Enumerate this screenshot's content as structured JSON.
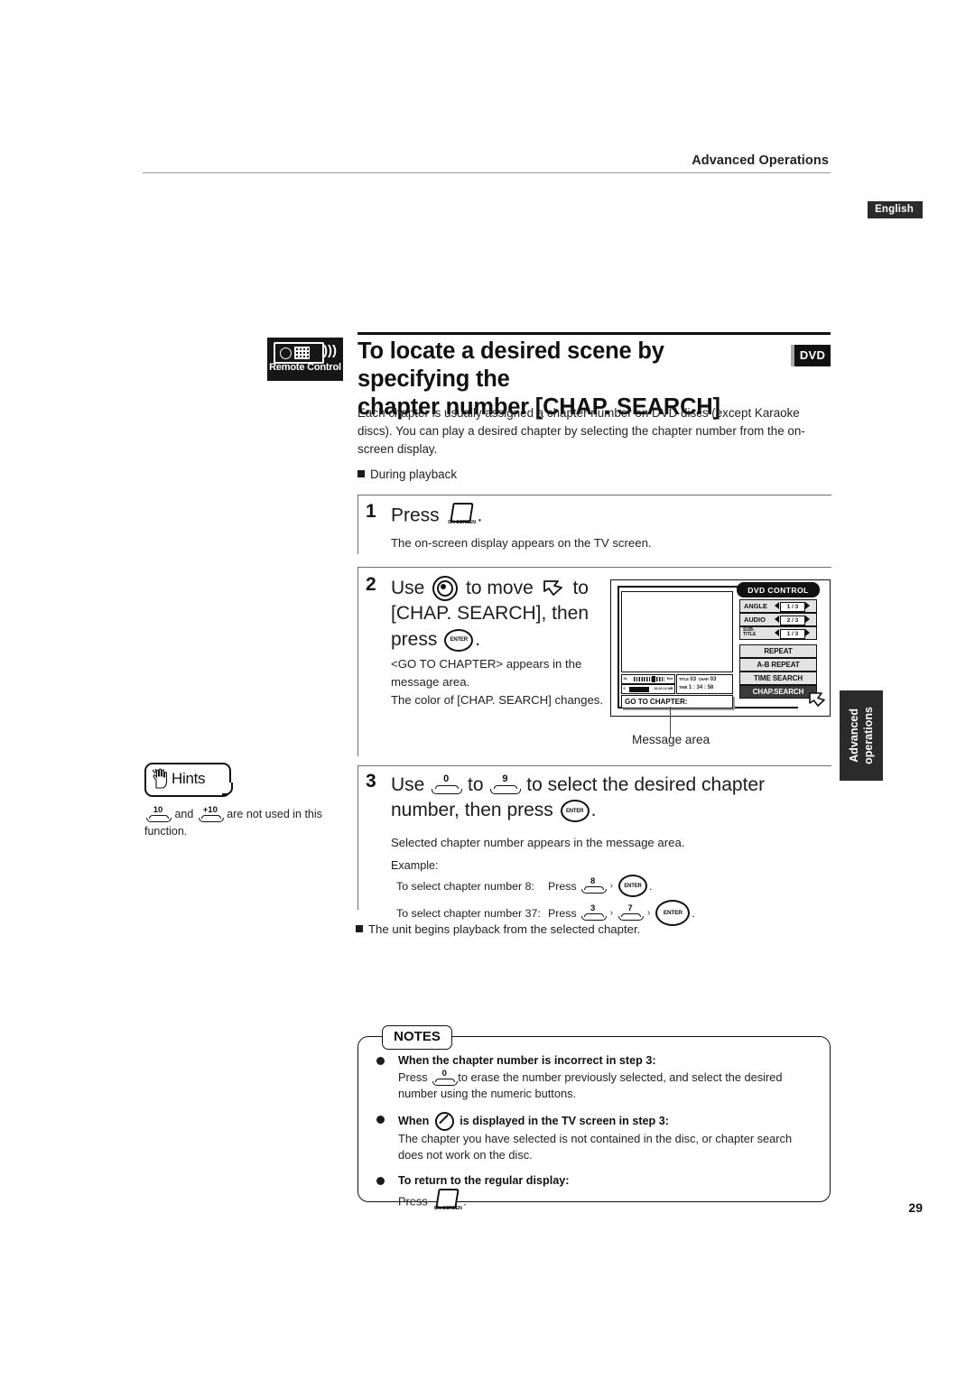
{
  "header": {
    "running_title": "Advanced Operations",
    "language_badge": "English"
  },
  "heading": {
    "remote_badge_label": "Remote Control",
    "title_line1": "To locate a desired scene by specifying the",
    "title_line2": "chapter number [CHAP. SEARCH]",
    "disc_badge": "DVD"
  },
  "intro": {
    "paragraph": "Each chapter is usually assigned a chapter number on DVD discs (except Karaoke discs). You can play a desired chapter by selecting the chapter number from the on-screen display.",
    "during_playback": "During playback"
  },
  "steps": [
    {
      "number": "1",
      "head_pre": "Press",
      "head_post": ".",
      "key_onscreen": "ON SCREEN",
      "body": "The on-screen display appears on the TV screen."
    },
    {
      "number": "2",
      "head_a": "Use",
      "head_b": "to move",
      "head_c": "to",
      "head_d": "[CHAP. SEARCH], then press",
      "head_e": ".",
      "key_enter": "ENTER",
      "body1": "<GO TO CHAPTER> appears in the message area.",
      "body2": "The color of [CHAP. SEARCH] changes."
    },
    {
      "number": "3",
      "head_a": "Use",
      "head_b": "to",
      "head_c": "to select the desired chapter number, then",
      "head_d": "press",
      "head_e": ".",
      "key_from": "0",
      "key_to": "9",
      "key_enter": "ENTER",
      "body1": "Selected chapter number appears in the message area.",
      "example_label": "Example:",
      "examples": [
        {
          "label": "To select chapter number 8:",
          "press_word": "Press",
          "keys": [
            "8"
          ],
          "enter": "ENTER",
          "end": "."
        },
        {
          "label": "To select chapter number 37:",
          "press_word": "Press",
          "keys": [
            "3",
            "7"
          ],
          "enter": "ENTER",
          "end": "."
        }
      ]
    }
  ],
  "after_steps": "The unit begins playback from the selected chapter.",
  "hints": {
    "badge_label": "Hints",
    "key_a": "10",
    "key_b": "+10",
    "text_mid": " and ",
    "text_tail": " are not used in this function."
  },
  "osd": {
    "panel_title": "DVD CONTROL",
    "meter1_left": "SL",
    "meter1_right": "End",
    "meter2_left": "0",
    "meter2_right": "00:01:12 MB",
    "info": {
      "title_label": "TITLE",
      "title_value": "03",
      "chap_label": "CHAP.",
      "chap_value": "03",
      "time_label": "TIME",
      "time_value": "1 : 34 : 58"
    },
    "message": "GO TO CHAPTER:",
    "selectors": [
      {
        "label": "ANGLE",
        "value": "1 / 3"
      },
      {
        "label": "AUDIO",
        "value": "2 / 3"
      },
      {
        "label_top": "SUB-",
        "label_bottom": "TITLE",
        "value": "1 / 3"
      }
    ],
    "buttons": [
      {
        "label": "REPEAT",
        "selected": false
      },
      {
        "label": "A-B REPEAT",
        "selected": false
      },
      {
        "label": "TIME SEARCH",
        "selected": false
      },
      {
        "label": "CHAP.SEARCH",
        "selected": true
      }
    ],
    "callout": "Message area"
  },
  "side_tab": {
    "line1": "Advanced",
    "line2": "operations"
  },
  "notes": {
    "label": "NOTES",
    "items": [
      {
        "title_pre": "When the chapter number is incorrect in step 3",
        "title_post": ":",
        "text_pre": "Press",
        "key": "0",
        "text_post": "to erase the number previously selected, and select the desired number using the numeric buttons."
      },
      {
        "title_pre": "When",
        "title_post": "is displayed in the TV screen in step 3:",
        "text": "The chapter you have selected is not contained in the disc, or chapter search does not work on the disc."
      },
      {
        "title_pre": "To return to the regular display:",
        "text_pre": "Press",
        "key_label": "ON SCREEN",
        "text_post": "."
      }
    ]
  },
  "page_number": "29",
  "colors": {
    "ink": "#1c1c1c",
    "badge_bg": "#2b2b2b",
    "selected_button_bg": "#3b3b3b"
  }
}
